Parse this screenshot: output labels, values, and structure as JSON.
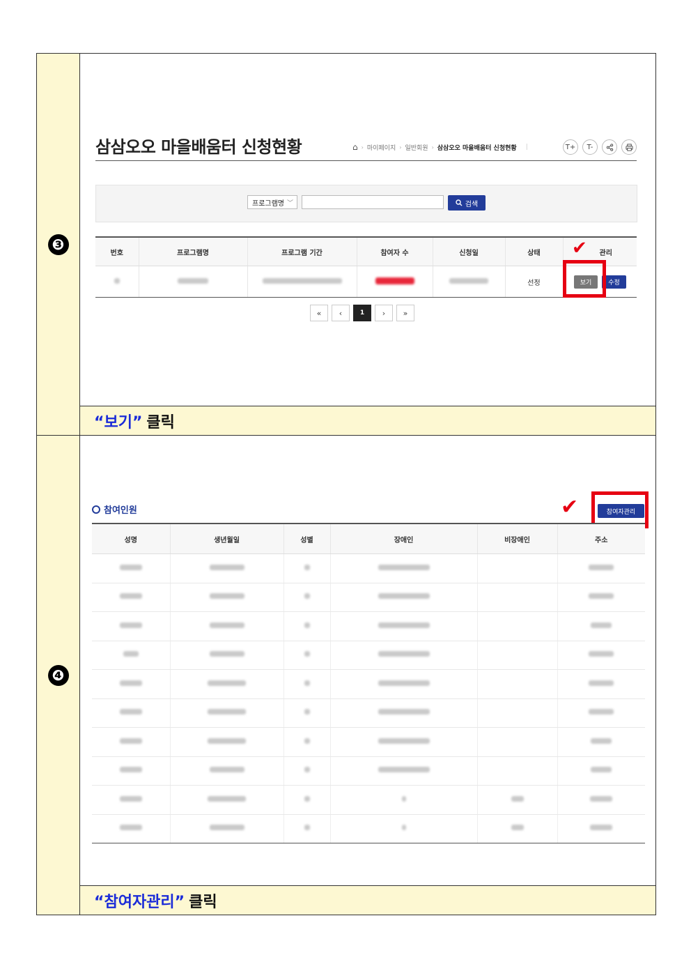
{
  "steps": [
    {
      "number": "❸",
      "caption_quoted": "“보기”",
      "caption_rest": "클릭",
      "page_title": "삼삼오오 마을배움터 신청현황",
      "breadcrumb": [
        "마이페이지",
        "일반회원",
        "삼삼오오 마을배움터 신청현황"
      ],
      "tools": [
        "T+",
        "T-",
        "share-icon",
        "print-icon"
      ],
      "search": {
        "select_label": "프로그램명",
        "button_label": "검색",
        "input_value": ""
      },
      "table": {
        "headers": [
          "번호",
          "프로그램명",
          "프로그램 기간",
          "참여자 수",
          "신청일",
          "상태",
          "관리"
        ],
        "rows": [
          {
            "status": "선정",
            "view_label": "보기",
            "edit_label": "수정"
          }
        ]
      },
      "pagination": {
        "first": "«",
        "prev": "‹",
        "current": "1",
        "next": "›",
        "last": "»"
      }
    },
    {
      "number": "❹",
      "caption_quoted": "“참여자관리”",
      "caption_rest": "클릭",
      "section_title": "참여인원",
      "manage_button": "참여자관리",
      "table": {
        "headers": [
          "성명",
          "생년월일",
          "성별",
          "장애인",
          "비장애인",
          "주소"
        ],
        "row_count": 10
      }
    }
  ],
  "colors": {
    "accent": "#223c9a",
    "highlight_red": "#e60012",
    "step_bg": "#fdf8d2",
    "caption_quote": "#1a2bd8"
  }
}
